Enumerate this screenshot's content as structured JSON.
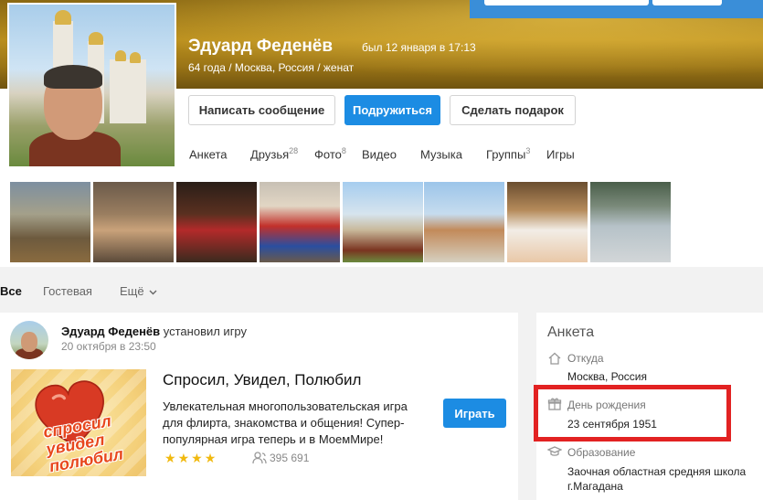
{
  "header": {
    "name": "Эдуард Феденёв",
    "last_seen": "был 12 января в 17:13",
    "info": "64 года / Москва, Россия / женат"
  },
  "actions": {
    "message": "Написать сообщение",
    "add_friend": "Подружиться",
    "gift": "Сделать подарок"
  },
  "tabs": [
    {
      "label": "Анкета",
      "count": ""
    },
    {
      "label": "Друзья",
      "count": "28"
    },
    {
      "label": "Фото",
      "count": "8"
    },
    {
      "label": "Видео",
      "count": ""
    },
    {
      "label": "Музыка",
      "count": ""
    },
    {
      "label": "Группы",
      "count": "3"
    },
    {
      "label": "Игры",
      "count": ""
    }
  ],
  "subtabs": {
    "all": "Все",
    "guestbook": "Гостевая",
    "more": "Ещё"
  },
  "feed": {
    "author": "Эдуард Феденёв",
    "action": "установил игру",
    "time": "20 октября в 23:50",
    "game": {
      "title": "Спросил, Увидел, Полюбил",
      "description": "Увлекательная многопользовательская игра для флирта, знакомства и общения! Супер-популярная игра теперь и в МоемМире!",
      "logo_text": "спросил увидел полюбил",
      "play_label": "Играть",
      "rating_stars": 4,
      "players": "395 691"
    }
  },
  "sidebar": {
    "title": "Анкета",
    "from_label": "Откуда",
    "from_value": "Москва, Россия",
    "birthday_label": "День рождения",
    "birthday_value": "23 сентября 1951",
    "education_label": "Образование",
    "education_value": "Заочная областная средняя школа г.Магадана"
  },
  "colors": {
    "accent": "#1c8ce3",
    "highlight": "#e22222",
    "star": "#f1b90f"
  }
}
